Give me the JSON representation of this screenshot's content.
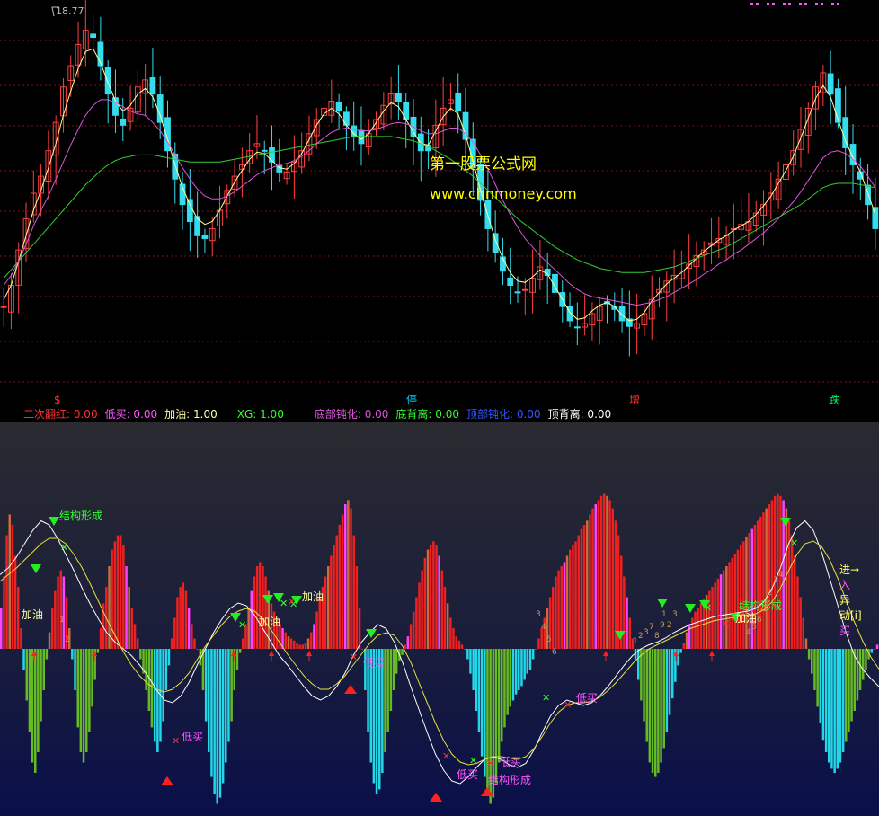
{
  "chart_data": [
    {
      "type": "line",
      "panel": "candlestick-price",
      "price_label": "18.77",
      "watermark": {
        "line1": "第一股票公式网",
        "line2": "www.chnmoney.com",
        "color": "#ffff00"
      },
      "marker_labels": [
        {
          "text": "$",
          "color": "#ff3030"
        },
        {
          "text": "停",
          "color": "#00ccff"
        },
        {
          "text": "增",
          "color": "#ff3030"
        },
        {
          "text": "跌",
          "color": "#00ff66"
        }
      ],
      "series": [
        {
          "key": "price_close",
          "color": "#ffffff",
          "values": [
            190,
            205,
            230,
            252,
            270,
            282,
            300,
            320,
            345,
            360,
            375,
            385,
            380,
            360,
            340,
            325,
            318,
            330,
            345,
            350,
            340,
            320,
            300,
            280,
            262,
            250,
            240,
            238,
            245,
            258,
            272,
            282,
            290,
            300,
            305,
            300,
            292,
            285,
            285,
            292,
            300,
            312,
            322,
            330,
            335,
            328,
            318,
            310,
            305,
            312,
            322,
            332,
            340,
            335,
            322,
            310,
            300,
            300,
            318,
            330,
            336,
            328,
            308,
            288,
            265,
            245,
            228,
            215,
            205,
            200,
            202,
            210,
            218,
            212,
            200,
            190,
            180,
            175,
            178,
            185,
            190,
            192,
            188,
            180,
            176,
            178,
            185,
            195,
            202,
            208,
            212,
            215,
            220,
            226,
            230,
            235,
            238,
            240,
            245,
            248,
            250,
            256,
            262,
            270,
            280,
            290,
            300,
            315,
            330,
            345,
            355,
            340,
            320,
            302,
            290,
            280,
            262,
            245
          ]
        },
        {
          "key": "ma_fast",
          "color": "#ffff99",
          "values": [
            195,
            205,
            222,
            240,
            258,
            272,
            288,
            305,
            325,
            342,
            358,
            370,
            372,
            362,
            348,
            335,
            328,
            332,
            340,
            344,
            338,
            325,
            308,
            290,
            274,
            262,
            252,
            248,
            250,
            258,
            268,
            278,
            286,
            294,
            299,
            298,
            293,
            288,
            287,
            291,
            298,
            308,
            318,
            326,
            330,
            326,
            318,
            312,
            308,
            312,
            320,
            328,
            334,
            331,
            322,
            313,
            305,
            304,
            314,
            324,
            330,
            326,
            311,
            293,
            272,
            254,
            237,
            224,
            214,
            208,
            207,
            211,
            216,
            213,
            204,
            195,
            186,
            181,
            182,
            187,
            191,
            193,
            190,
            184,
            180,
            181,
            186,
            194,
            200,
            206,
            210,
            214,
            219,
            224,
            229,
            233,
            237,
            240,
            244,
            247,
            250,
            255,
            261,
            268,
            277,
            286,
            296,
            309,
            323,
            337,
            346,
            338,
            322,
            307,
            295,
            285,
            270,
            255
          ]
        },
        {
          "key": "ma_mid",
          "color": "#dd55dd",
          "values": [
            205,
            212,
            222,
            234,
            247,
            258,
            268,
            280,
            292,
            304,
            315,
            325,
            332,
            336,
            336,
            334,
            331,
            328,
            326,
            325,
            320,
            314,
            306,
            297,
            288,
            280,
            273,
            268,
            266,
            266,
            268,
            271,
            275,
            279,
            283,
            286,
            288,
            290,
            291,
            293,
            296,
            300,
            305,
            309,
            313,
            315,
            316,
            315,
            314,
            314,
            315,
            317,
            319,
            320,
            319,
            317,
            314,
            312,
            312,
            314,
            316,
            316,
            312,
            306,
            297,
            287,
            276,
            265,
            255,
            246,
            238,
            232,
            226,
            221,
            216,
            211,
            206,
            202,
            199,
            197,
            196,
            195,
            194,
            193,
            192,
            191,
            192,
            193,
            195,
            197,
            200,
            203,
            206,
            209,
            213,
            216,
            220,
            223,
            227,
            230,
            234,
            238,
            242,
            247,
            252,
            258,
            264,
            271,
            279,
            287,
            295,
            299,
            300,
            298,
            294,
            289,
            282,
            274
          ]
        },
        {
          "key": "ma_slow",
          "color": "#33cc33",
          "values": [
            210,
            216,
            222,
            228,
            234,
            240,
            246,
            252,
            258,
            264,
            270,
            276,
            281,
            286,
            290,
            293,
            295,
            296,
            297,
            297,
            297,
            296,
            295,
            294,
            293,
            292,
            292,
            292,
            292,
            292,
            293,
            294,
            295,
            296,
            297,
            298,
            299,
            300,
            301,
            302,
            303,
            304,
            305,
            306,
            307,
            308,
            309,
            310,
            310,
            310,
            310,
            310,
            310,
            309,
            308,
            307,
            305,
            303,
            300,
            297,
            294,
            290,
            286,
            282,
            277,
            272,
            267,
            262,
            257,
            252,
            248,
            244,
            240,
            236,
            232,
            229,
            226,
            223,
            221,
            219,
            217,
            216,
            215,
            214,
            214,
            214,
            214,
            215,
            216,
            217,
            218,
            220,
            222,
            224,
            226,
            228,
            230,
            232,
            235,
            238,
            241,
            244,
            247,
            250,
            253,
            256,
            259,
            262,
            266,
            270,
            274,
            276,
            277,
            277,
            277,
            276,
            275,
            274
          ]
        }
      ]
    },
    {
      "type": "bar",
      "panel": "indicator",
      "legend": [
        {
          "name": "二次翻红",
          "value": "0.00",
          "color": "#ff3030"
        },
        {
          "name": "低买",
          "value": "0.00",
          "color": "#ff55ff"
        },
        {
          "name": "加油",
          "value": "1.00",
          "color": "#ffffaa"
        },
        {
          "name": "XG",
          "value": "1.00",
          "color": "#33ff33"
        },
        {
          "name": "底部钝化",
          "value": "0.00",
          "color": "#dd55dd"
        },
        {
          "name": "底背离",
          "value": "0.00",
          "color": "#33ff33"
        },
        {
          "name": "顶部钝化",
          "value": "0.00",
          "color": "#3355ff"
        },
        {
          "name": "顶背离",
          "value": "0.00",
          "color": "#ffffff"
        }
      ],
      "annotations": [
        {
          "text": "结构形成",
          "color": "#33ff33"
        },
        {
          "text": "加油",
          "color": "#ffff99"
        },
        {
          "text": "加油",
          "color": "#ffff99"
        },
        {
          "text": "加油",
          "color": "#ffff99"
        },
        {
          "text": "加油",
          "color": "#ffff99"
        },
        {
          "text": "低买",
          "color": "#ff55ff"
        },
        {
          "text": "低买",
          "color": "#ff55ff"
        },
        {
          "text": "低买",
          "color": "#ff55ff"
        },
        {
          "text": "低买",
          "color": "#ff55ff"
        },
        {
          "text": "低买",
          "color": "#ff55ff"
        },
        {
          "text": "结构形成",
          "color": "#ff55ff"
        },
        {
          "text": "结构形成",
          "color": "#33ff33"
        }
      ],
      "side_text": [
        {
          "text": "进→",
          "color": "#ffff66"
        },
        {
          "text": "入",
          "color": "#ff55ff"
        },
        {
          "text": "异",
          "color": "#ffff66"
        },
        {
          "text": "动[i]",
          "color": "#ffff66"
        },
        {
          "text": "买",
          "color": "#ff55ff"
        }
      ],
      "digits": [
        "1",
        "2",
        "3",
        "4",
        "5",
        "6",
        "7",
        "8",
        "9",
        "1",
        "2",
        "3",
        "1",
        "2",
        "3",
        "4",
        "5",
        "6",
        "1",
        "2",
        "3",
        "4"
      ],
      "values": [
        20,
        35,
        55,
        65,
        60,
        45,
        30,
        10,
        -10,
        -25,
        -40,
        -55,
        -60,
        -50,
        -35,
        -20,
        -5,
        8,
        20,
        28,
        35,
        38,
        35,
        25,
        10,
        -5,
        -20,
        -38,
        -50,
        -55,
        -50,
        -40,
        -28,
        -15,
        -2,
        10,
        22,
        30,
        40,
        48,
        52,
        55,
        55,
        50,
        40,
        30,
        20,
        12,
        5,
        -5,
        -12,
        -20,
        -30,
        -38,
        -45,
        -50,
        -45,
        -35,
        -20,
        -8,
        5,
        15,
        25,
        30,
        32,
        28,
        20,
        12,
        5,
        0,
        -8,
        -20,
        -35,
        -50,
        -62,
        -70,
        -75,
        -72,
        -65,
        -55,
        -45,
        -35,
        -20,
        -10,
        -2,
        5,
        12,
        20,
        28,
        35,
        40,
        42,
        40,
        35,
        28,
        22,
        18,
        15,
        12,
        10,
        8,
        6,
        5,
        4,
        3,
        2,
        2,
        3,
        5,
        8,
        12,
        18,
        25,
        30,
        35,
        40,
        45,
        50,
        55,
        60,
        65,
        70,
        72,
        68,
        55,
        40,
        20,
        0,
        -20,
        -40,
        -55,
        -65,
        -70,
        -68,
        -60,
        -50,
        -40,
        -30,
        -20,
        -12,
        -6,
        -3,
        2,
        6,
        12,
        18,
        25,
        32,
        38,
        44,
        48,
        50,
        52,
        50,
        45,
        38,
        30,
        22,
        15,
        10,
        6,
        4,
        2,
        0,
        -5,
        -12,
        -20,
        -30,
        -40,
        -52,
        -62,
        -70,
        -75,
        -72,
        -65,
        -55,
        -45,
        -38,
        -32,
        -28,
        -25,
        -22,
        -20,
        -18,
        -15,
        -12,
        -10,
        -5,
        0,
        5,
        10,
        15,
        20,
        25,
        30,
        35,
        38,
        40,
        42,
        45,
        48,
        50,
        52,
        55,
        58,
        60,
        62,
        65,
        68,
        70,
        72,
        74,
        75,
        74,
        72,
        68,
        62,
        55,
        45,
        35,
        25,
        15,
        5,
        -5,
        -15,
        -25,
        -35,
        -45,
        -55,
        -60,
        -62,
        -60,
        -55,
        -48,
        -40,
        -32,
        -24,
        -16,
        -8,
        -2,
        3,
        8,
        12,
        15,
        18,
        20,
        22,
        24,
        26,
        28,
        30,
        32,
        34,
        36,
        38,
        40,
        42,
        44,
        46,
        48,
        50,
        52,
        54,
        56,
        58,
        60,
        62,
        64,
        66,
        68,
        70,
        72,
        74,
        75,
        74,
        72,
        68,
        62,
        55,
        45,
        35,
        25,
        15,
        5,
        -5,
        -12,
        -20,
        -28,
        -36,
        -44,
        -50,
        -55,
        -58,
        -60,
        -58,
        -55,
        -50,
        -45,
        -40,
        -35,
        -30,
        -25,
        -20,
        -15,
        -10,
        -5,
        -2,
        0,
        2
      ],
      "line_white": [
        0.55,
        0.6,
        0.68,
        0.78,
        0.88,
        0.95,
        0.92,
        0.82,
        0.7,
        0.58,
        0.45,
        0.33,
        0.22,
        0.12,
        0.05,
        0.0,
        -0.05,
        -0.12,
        -0.2,
        -0.3,
        -0.38,
        -0.4,
        -0.35,
        -0.25,
        -0.12,
        0.0,
        0.12,
        0.22,
        0.3,
        0.34,
        0.32,
        0.25,
        0.15,
        0.05,
        -0.05,
        -0.12,
        -0.2,
        -0.28,
        -0.35,
        -0.38,
        -0.35,
        -0.28,
        -0.18,
        -0.05,
        0.05,
        0.12,
        0.18,
        0.15,
        0.05,
        -0.1,
        -0.28,
        -0.45,
        -0.62,
        -0.78,
        -0.9,
        -0.98,
        -1.0,
        -0.95,
        -0.88,
        -0.82,
        -0.8,
        -0.82,
        -0.86,
        -0.88,
        -0.85,
        -0.75,
        -0.62,
        -0.5,
        -0.42,
        -0.38,
        -0.4,
        -0.42,
        -0.4,
        -0.35,
        -0.28,
        -0.2,
        -0.12,
        -0.05,
        0.0,
        0.03,
        0.05,
        0.08,
        0.12,
        0.15,
        0.18,
        0.2,
        0.22,
        0.24,
        0.25,
        0.26,
        0.27,
        0.28,
        0.3,
        0.35,
        0.45,
        0.6,
        0.78,
        0.9,
        0.95,
        0.88,
        0.72,
        0.52,
        0.32,
        0.12,
        -0.05,
        -0.15,
        -0.22,
        -0.28
      ],
      "line_yellow": [
        0.5,
        0.55,
        0.6,
        0.66,
        0.72,
        0.78,
        0.82,
        0.82,
        0.78,
        0.7,
        0.6,
        0.48,
        0.35,
        0.22,
        0.1,
        -0.02,
        -0.12,
        -0.2,
        -0.26,
        -0.3,
        -0.32,
        -0.3,
        -0.25,
        -0.18,
        -0.08,
        0.02,
        0.1,
        0.18,
        0.24,
        0.28,
        0.3,
        0.28,
        0.22,
        0.14,
        0.05,
        -0.04,
        -0.12,
        -0.2,
        -0.26,
        -0.3,
        -0.3,
        -0.26,
        -0.2,
        -0.12,
        -0.04,
        0.04,
        0.1,
        0.12,
        0.1,
        0.02,
        -0.1,
        -0.25,
        -0.4,
        -0.55,
        -0.68,
        -0.78,
        -0.84,
        -0.86,
        -0.85,
        -0.82,
        -0.8,
        -0.8,
        -0.81,
        -0.82,
        -0.8,
        -0.74,
        -0.65,
        -0.55,
        -0.47,
        -0.42,
        -0.4,
        -0.4,
        -0.39,
        -0.36,
        -0.31,
        -0.25,
        -0.18,
        -0.11,
        -0.05,
        0.0,
        0.03,
        0.06,
        0.09,
        0.12,
        0.15,
        0.17,
        0.19,
        0.21,
        0.22,
        0.23,
        0.24,
        0.25,
        0.26,
        0.29,
        0.35,
        0.45,
        0.58,
        0.7,
        0.78,
        0.8,
        0.76,
        0.66,
        0.52,
        0.36,
        0.2,
        0.06,
        -0.06,
        -0.15
      ]
    }
  ]
}
